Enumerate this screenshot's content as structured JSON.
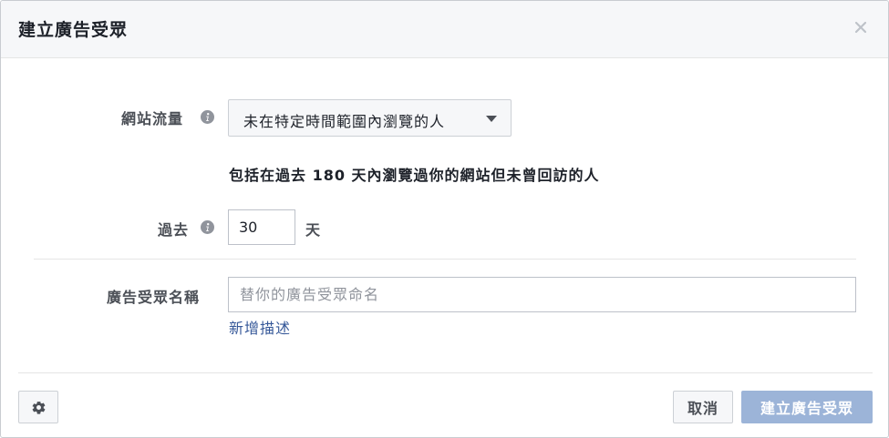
{
  "dialog": {
    "title": "建立廣告受眾",
    "close_icon": "close-icon"
  },
  "traffic": {
    "label": "網站流量",
    "info_icon": "info-icon",
    "dropdown_value": "未在特定時間範圍內瀏覽的人",
    "helper_text": "包括在過去 180 天內瀏覽過你的網站但未曾回訪的人"
  },
  "period": {
    "label": "過去",
    "info_icon": "info-icon",
    "value": "30",
    "unit": "天"
  },
  "audience_name": {
    "label": "廣告受眾名稱",
    "placeholder": "替你的廣告受眾命名",
    "add_description_link": "新增描述"
  },
  "footer": {
    "settings_icon": "gear-icon",
    "cancel_label": "取消",
    "create_label": "建立廣告受眾"
  },
  "colors": {
    "header_bg": "#f6f7f9",
    "link": "#365899",
    "primary_disabled": "#9cb4d8",
    "text": "#1d2129",
    "label": "#4b4f56"
  }
}
